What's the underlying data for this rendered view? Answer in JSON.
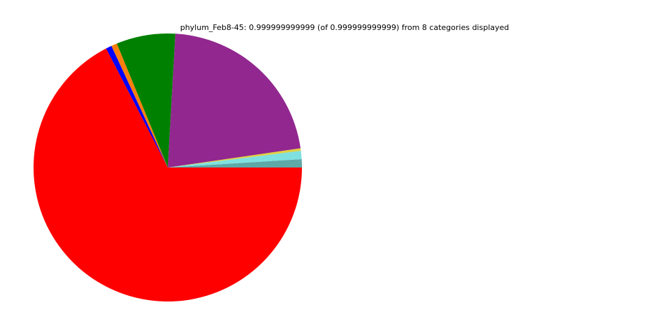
{
  "chart_data": {
    "type": "pie",
    "title": "phylum_Feb8-45: 0.999999999999 (of 0.999999999999) from 8 categories displayed",
    "total": 0.999999999999,
    "category_count": 8,
    "start_angle_deg": 0,
    "direction": "counterclockwise",
    "legend": "none",
    "slices": [
      {
        "value": 0.01,
        "color": "#5fa8a8"
      },
      {
        "value": 0.01,
        "color": "#7fe0e0"
      },
      {
        "value": 0.003,
        "color": "#e0d040"
      },
      {
        "value": 0.218,
        "color": "#92278f"
      },
      {
        "value": 0.071,
        "color": "#008000"
      },
      {
        "value": 0.007,
        "color": "#ff7f0e"
      },
      {
        "value": 0.007,
        "color": "#0000ff"
      },
      {
        "value": 0.674,
        "color": "#ff0000"
      }
    ]
  }
}
